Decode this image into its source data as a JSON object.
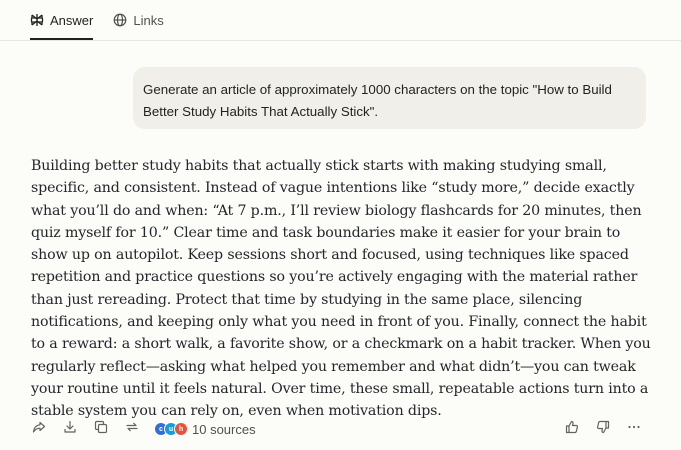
{
  "tabs": [
    {
      "label": "Answer",
      "icon": "perplexity-logo-icon",
      "active": true
    },
    {
      "label": "Links",
      "icon": "globe-icon",
      "active": false
    }
  ],
  "query": {
    "text": "Generate an article of approximately 1000 characters on the topic \"How to Build Better Study Habits That Actually Stick\"."
  },
  "answer": {
    "text": "Building better study habits that actually stick starts with making studying small, specific, and consistent. Instead of vague intentions like “study more,” decide exactly what you’ll do and when: “At 7 p.m., I’ll review biology flashcards for 20 minutes, then quiz myself for 10.” Clear time and task boundaries make it easier for your brain to show up on autopilot. Keep sessions short and focused, using techniques like spaced repetition and practice questions so you’re actively engaging with the material rather than just rereading. Protect that time by studying in the same place, silencing notifications, and keeping only what you need in front of you. Finally, connect the habit to a reward: a short walk, a favorite show, or a checkmark on a habit tracker. When you regularly reflect—asking what helped you remember and what didn’t—you can tweak your routine until it feels natural. Over time, these small, repeatable actions turn into a stable system you can rely on, even when motivation dips."
  },
  "actions": {
    "left_icons": [
      "share-icon",
      "download-icon",
      "copy-icon",
      "rewrite-icon"
    ],
    "sources_label": "10 sources",
    "source_favicons": [
      {
        "name": "source-favicon",
        "color": "#2f6fd6"
      },
      {
        "name": "source-favicon",
        "color": "#1a9ad6"
      },
      {
        "name": "source-favicon",
        "color": "#e2553d"
      }
    ],
    "right_icons": [
      "thumbs-up-icon",
      "thumbs-down-icon",
      "more-icon"
    ]
  }
}
